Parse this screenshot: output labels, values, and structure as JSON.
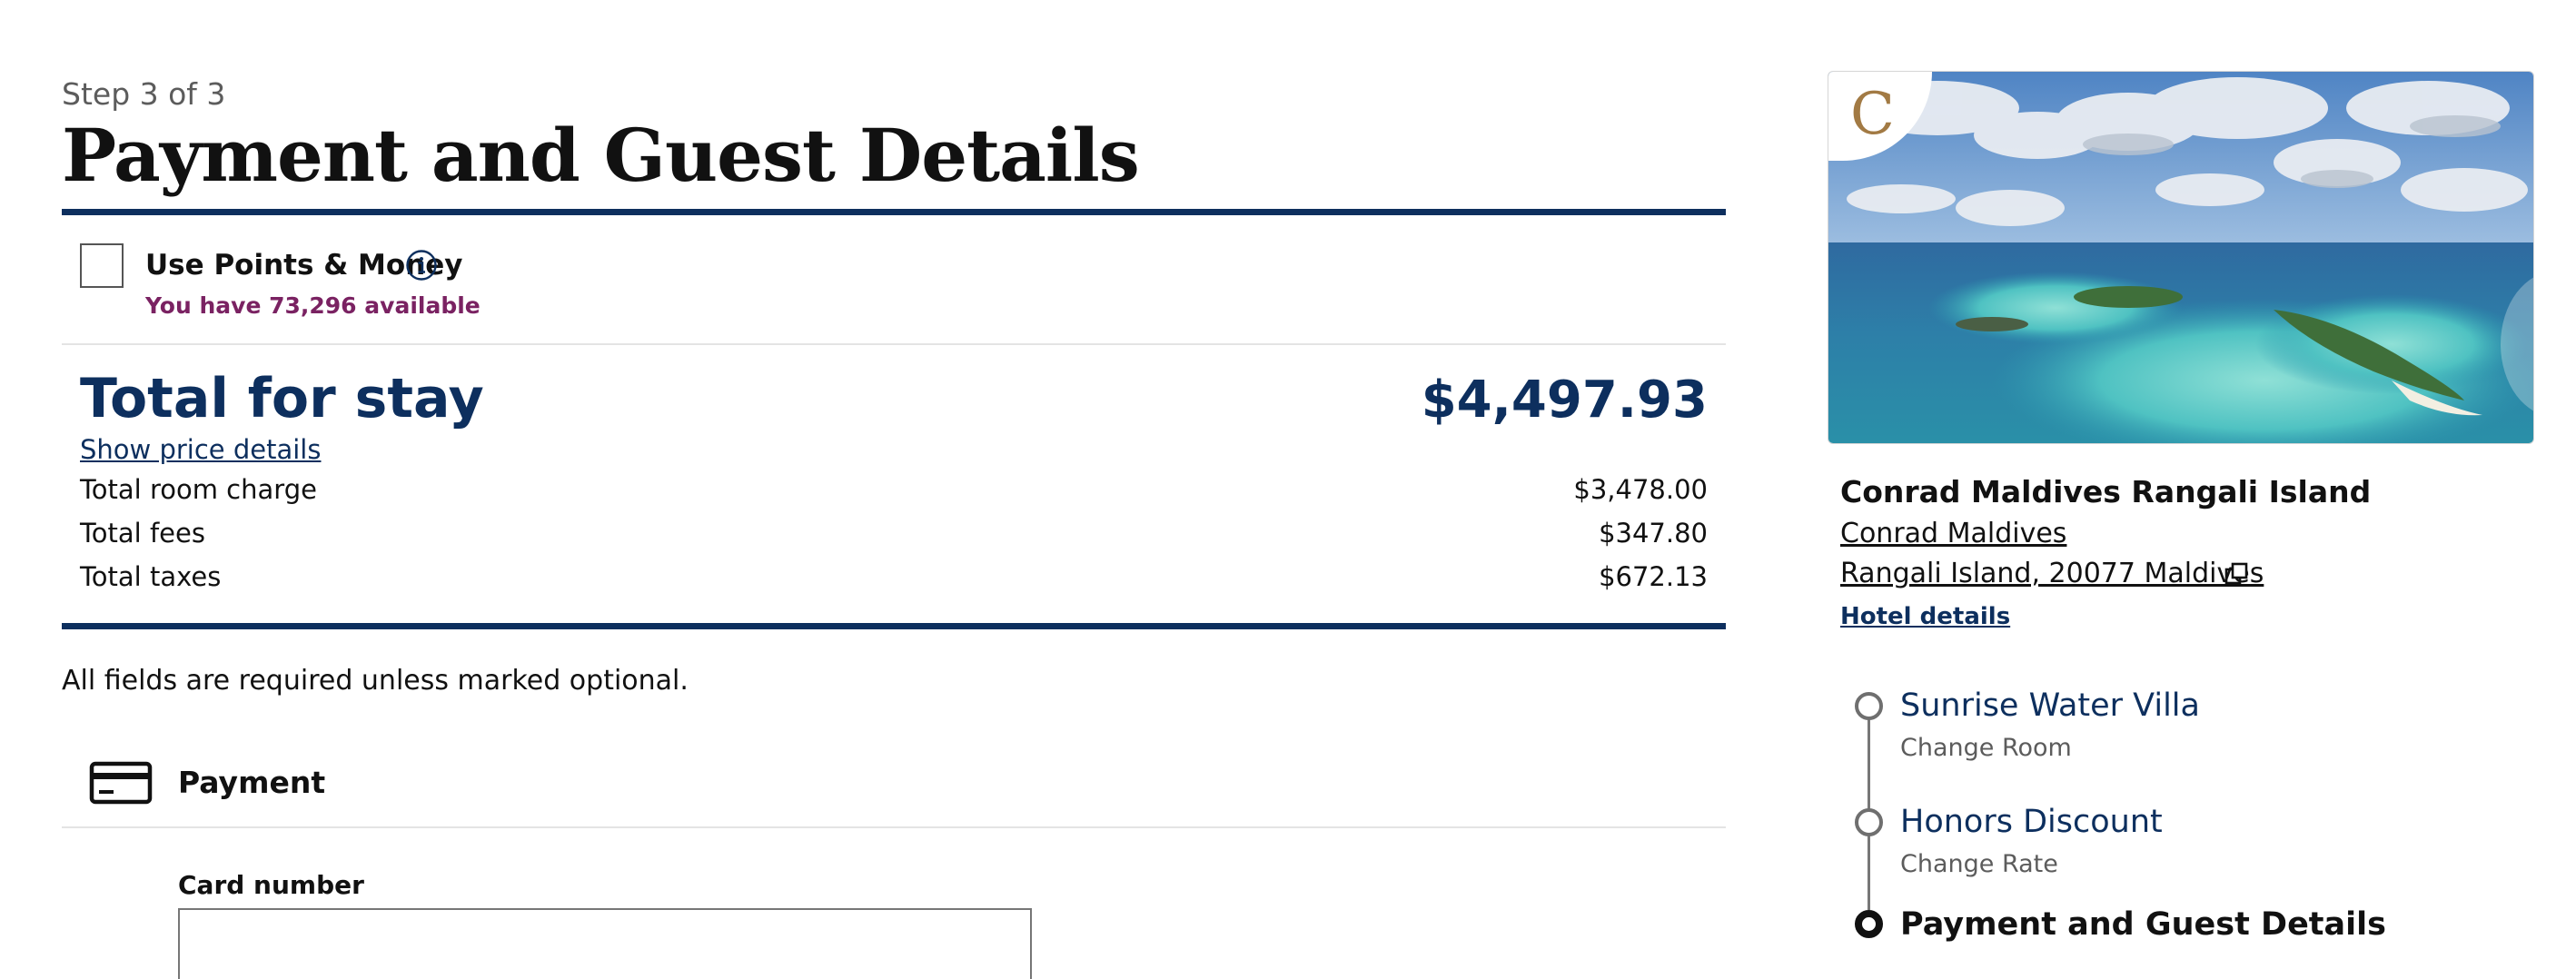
{
  "header": {
    "step": "Step 3 of 3",
    "title": "Payment and Guest Details"
  },
  "points": {
    "label": "Use Points & Money",
    "available": "You have 73,296 available",
    "checked": false
  },
  "total": {
    "title": "Total for stay",
    "amount": "$4,497.93",
    "details_link": "Show price details",
    "lines": [
      {
        "label": "Total room charge",
        "value": "$3,478.00"
      },
      {
        "label": "Total fees",
        "value": "$347.80"
      },
      {
        "label": "Total taxes",
        "value": "$672.13"
      }
    ]
  },
  "form": {
    "required_note": "All fields are required unless marked optional.",
    "payment_heading": "Payment",
    "card_number_label": "Card number",
    "card_number_value": ""
  },
  "hotel": {
    "brand_letter": "C",
    "name": "Conrad Maldives Rangali Island",
    "brand": "Conrad Maldives",
    "address": "Rangali Island, 20077 Maldives",
    "details_link": "Hotel details"
  },
  "progress": {
    "steps": [
      {
        "title": "Sunrise Water Villa",
        "action": "Change Room"
      },
      {
        "title": "Honors Discount",
        "action": "Change Rate"
      },
      {
        "title": "Payment and Guest Details",
        "action": ""
      }
    ]
  },
  "colors": {
    "navy": "#0d2f5e",
    "points_purple": "#7a2262",
    "brand_gold": "#a27a44"
  }
}
